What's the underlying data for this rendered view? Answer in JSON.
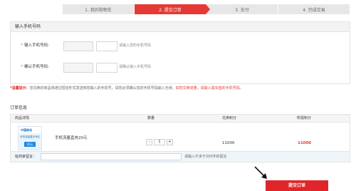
{
  "steps": [
    "1. 我的购物车",
    "2. 提交订单",
    "3. 支付",
    "4. 完成交易"
  ],
  "phone_section": {
    "title": "输入手机号码",
    "phone_label": "输入手机号码:",
    "phone_hint": "请输入您的手机号码",
    "confirm_label": "确认手机号码:",
    "confirm_hint": "请确认输入手机号码"
  },
  "tip": {
    "label": "*温馨提示：",
    "text": "您兑换的商品将通过短信形式发送到您输入的手机号，请您必须确认您的手机号码输入无误，",
    "warning": "如您兑换流量，请输入需充值的手机号码。"
  },
  "order": {
    "title": "订单信息",
    "headers": {
      "product": "商品详情",
      "qty": "数量",
      "points": "兑换积分",
      "total": "所需积分"
    },
    "product_name": "手机流量直充20元",
    "image_brand": "中国移动",
    "image_text": "手机流量直充专区",
    "image_badge": "20元",
    "quantity": "1",
    "minus": "-",
    "plus": "+",
    "points": "11000",
    "total": "11000",
    "note_label": "给商家留言：",
    "note_hint": "请输入不多于200字的留言"
  },
  "submit_label": "提交订单",
  "colors": {
    "accent": "#e53935",
    "step_inactive": "#e7e7e7"
  }
}
